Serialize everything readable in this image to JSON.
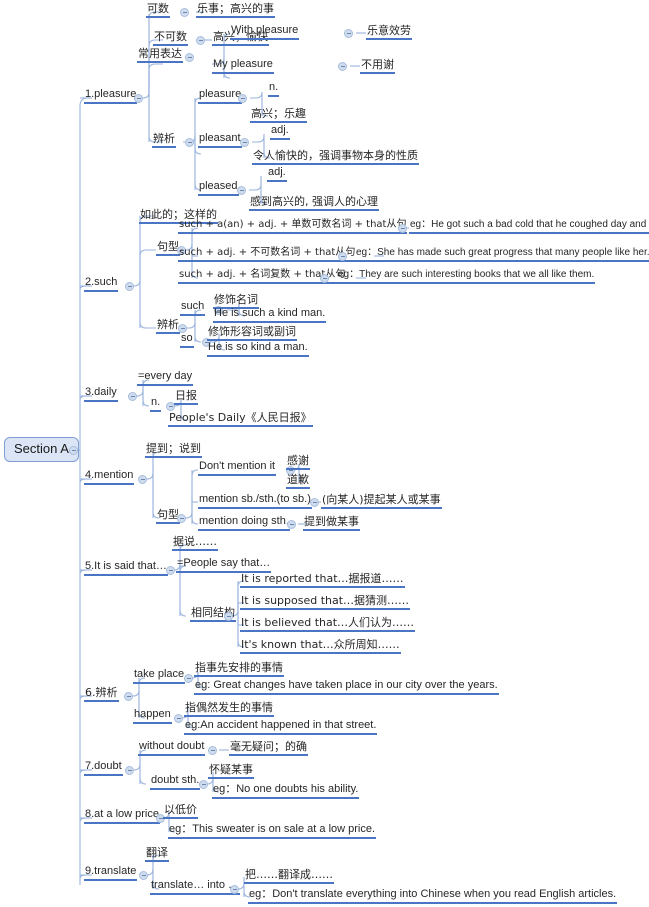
{
  "title": "Section A",
  "root": {
    "label": "Section A"
  },
  "colors": {
    "underline": "#4a74c4",
    "connector": "#9bb4de",
    "root_fill": "#dbe5f5",
    "root_border": "#7f9fd4",
    "text": "#262626",
    "handle_fill": "#cfdcee"
  },
  "icons": {
    "collapse": "collapse-minus-icon"
  },
  "branches": [
    {
      "id": "pleasure",
      "label": "1.pleasure",
      "children": [
        {
          "label": "可数",
          "children": [
            {
              "label": "乐事；高兴的事"
            }
          ]
        },
        {
          "label": "不可数",
          "children": [
            {
              "label": "高兴；愉快"
            }
          ]
        },
        {
          "label": "常用表达",
          "children": [
            {
              "label": "With pleasure",
              "children": [
                {
                  "label": "乐意效劳"
                }
              ]
            },
            {
              "label": "My pleasure",
              "children": [
                {
                  "label": "不用谢"
                }
              ]
            }
          ]
        },
        {
          "label": "辨析",
          "children": [
            {
              "label": "pleasure",
              "children": [
                {
                  "label": "n."
                },
                {
                  "label": "高兴；乐趣"
                }
              ]
            },
            {
              "label": "pleasant",
              "children": [
                {
                  "label": "adj."
                },
                {
                  "label": "令人愉快的，强调事物本身的性质"
                }
              ]
            },
            {
              "label": "pleased",
              "children": [
                {
                  "label": "adj."
                },
                {
                  "label": "感到高兴的, 强调人的心理"
                }
              ]
            }
          ]
        }
      ]
    },
    {
      "id": "such",
      "label": "2.such",
      "children": [
        {
          "label": "如此的；这样的"
        },
        {
          "label": "句型",
          "children": [
            {
              "label": "such + a(an) + adj. + 单数可数名词 + that从句",
              "children": [
                {
                  "label": "eg：He got such a bad cold that he coughed day and night."
                }
              ]
            },
            {
              "label": "such + adj. + 不可数名词 + that从句",
              "children": [
                {
                  "label": "eg：She has made such great progress that many  people like her."
                }
              ]
            },
            {
              "label": "such + adj. + 名词复数 + that从句",
              "children": [
                {
                  "label": "eg：They are such interesting books that we all like them."
                }
              ]
            }
          ]
        },
        {
          "label": "辨析",
          "children": [
            {
              "label": "such",
              "children": [
                {
                  "label": "修饰名词"
                },
                {
                  "label": "He is such a kind man."
                }
              ]
            },
            {
              "label": "so",
              "children": [
                {
                  "label": "修饰形容词或副词"
                },
                {
                  "label": "He is so kind a man."
                }
              ]
            }
          ]
        }
      ]
    },
    {
      "id": "daily",
      "label": "3.daily",
      "children": [
        {
          "label": "=every day"
        },
        {
          "label": "n.",
          "children": [
            {
              "label": "日报"
            },
            {
              "label": "People's Daily《人民日报》"
            }
          ]
        }
      ]
    },
    {
      "id": "mention",
      "label": "4.mention",
      "children": [
        {
          "label": "提到；说到"
        },
        {
          "label": "句型",
          "children": [
            {
              "label": "Don't mention it",
              "children": [
                {
                  "label": "感谢"
                },
                {
                  "label": "道歉"
                }
              ]
            },
            {
              "label": "mention sb./sth.(to sb.)",
              "children": [
                {
                  "label": "(向某人)提起某人或某事"
                }
              ]
            },
            {
              "label": "mention doing sth.",
              "children": [
                {
                  "label": "提到做某事"
                }
              ]
            }
          ]
        }
      ]
    },
    {
      "id": "itissaid",
      "label": "5.It is said that…",
      "children": [
        {
          "label": "据说……"
        },
        {
          "label": "=People say that…"
        },
        {
          "label": "相同结构",
          "children": [
            {
              "label": "It is reported that…据报道……"
            },
            {
              "label": "It is supposed that…据猜测……"
            },
            {
              "label": "It is believed that…人们认为……"
            },
            {
              "label": "It's known that…众所周知……"
            }
          ]
        }
      ]
    },
    {
      "id": "bianxi6",
      "label": "6.辨析",
      "children": [
        {
          "label": "take place",
          "children": [
            {
              "label": "指事先安排的事情"
            },
            {
              "label": "eg: Great changes have taken place in our city over the years."
            }
          ]
        },
        {
          "label": "happen",
          "children": [
            {
              "label": "指偶然发生的事情"
            },
            {
              "label": "eg:An accident happened in that street."
            }
          ]
        }
      ]
    },
    {
      "id": "doubt",
      "label": "7.doubt",
      "children": [
        {
          "label": "without doubt",
          "children": [
            {
              "label": "毫无疑问；的确"
            }
          ]
        },
        {
          "label": "doubt sth.",
          "children": [
            {
              "label": "怀疑某事"
            },
            {
              "label": "eg：No one doubts his ability."
            }
          ]
        }
      ]
    },
    {
      "id": "lowprice",
      "label": "8.at a low price",
      "children": [
        {
          "label": "以低价"
        },
        {
          "label": "eg：This sweater is on sale at a low price."
        }
      ]
    },
    {
      "id": "translate",
      "label": "9.translate",
      "children": [
        {
          "label": "翻译"
        },
        {
          "label": "translate… into …",
          "children": [
            {
              "label": "把……翻译成……"
            },
            {
              "label": "eg：Don't translate everything into Chinese  when you read English articles."
            }
          ]
        }
      ]
    }
  ]
}
